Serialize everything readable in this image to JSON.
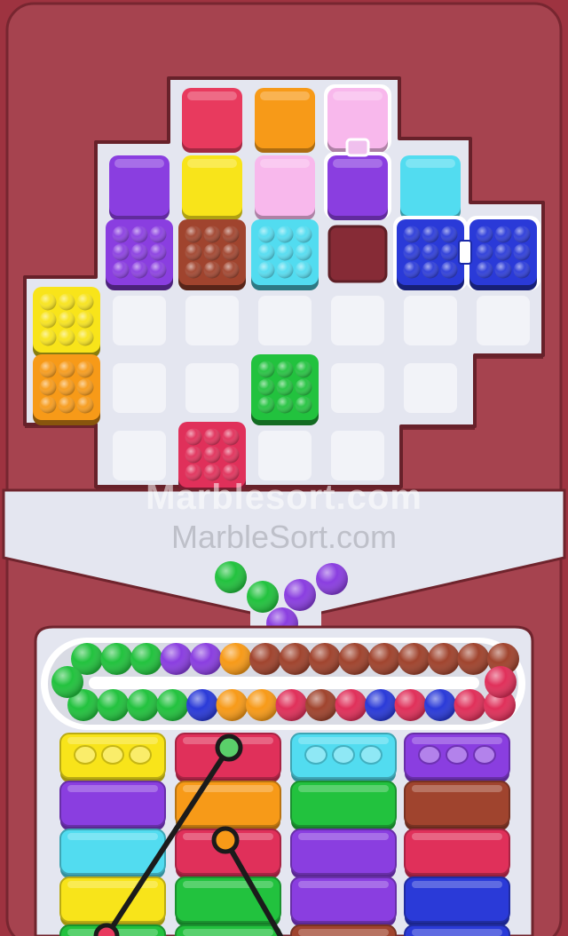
{
  "watermarks": {
    "primary": "Marblesort.com",
    "secondary": "MarbleSort.com"
  },
  "colors": {
    "frame": "#9e3340",
    "board": "#e4e6f0",
    "empty_slot": "#f2f3f8",
    "red": "#e83a5e",
    "orange": "#f79a18",
    "pink": "#f8b8ec",
    "purple": "#8a3ee0",
    "yellow": "#f8e41a",
    "cyan": "#52dcf0",
    "blue": "#2a3ad8",
    "brown": "#a0442e",
    "green": "#22c23e",
    "crimson": "#e0305a"
  },
  "board_pieces": {
    "flat_tiles": [
      {
        "row": 0,
        "col": 2,
        "color": "red"
      },
      {
        "row": 0,
        "col": 3,
        "color": "orange"
      },
      {
        "row": 0,
        "col": 4,
        "color": "pink",
        "selected": true
      },
      {
        "row": 1,
        "col": 1,
        "color": "purple"
      },
      {
        "row": 1,
        "col": 2,
        "color": "yellow"
      },
      {
        "row": 1,
        "col": 3,
        "color": "pink"
      },
      {
        "row": 1,
        "col": 4,
        "color": "purple",
        "selected": true
      },
      {
        "row": 1,
        "col": 5,
        "color": "cyan"
      }
    ],
    "marble_boxes": [
      {
        "row": 2,
        "col": 1,
        "color": "purple"
      },
      {
        "row": 2,
        "col": 2,
        "color": "brown"
      },
      {
        "row": 2,
        "col": 3,
        "color": "cyan"
      },
      {
        "row": 2,
        "col": 5,
        "color": "blue",
        "linked": true
      },
      {
        "row": 2,
        "col": 6,
        "color": "blue",
        "linked": true
      },
      {
        "row": 3,
        "col": 0,
        "color": "yellow"
      },
      {
        "row": 4,
        "col": 0,
        "color": "orange"
      },
      {
        "row": 4,
        "col": 3,
        "color": "green"
      },
      {
        "row": 5,
        "col": 2,
        "color": "crimson"
      }
    ],
    "hole": {
      "row": 2,
      "col": 4
    },
    "empty_slots": [
      [
        3,
        1
      ],
      [
        3,
        2
      ],
      [
        3,
        3
      ],
      [
        3,
        4
      ],
      [
        3,
        5
      ],
      [
        3,
        6
      ],
      [
        4,
        1
      ],
      [
        4,
        2
      ],
      [
        4,
        4
      ],
      [
        4,
        5
      ],
      [
        5,
        1
      ],
      [
        5,
        3
      ],
      [
        5,
        4
      ]
    ]
  },
  "falling_marbles": [
    "green",
    "green",
    "purple",
    "purple",
    "purple"
  ],
  "conveyor": {
    "top_row": [
      "green",
      "green",
      "green",
      "purple",
      "purple",
      "orange",
      "brown",
      "brown",
      "brown",
      "brown",
      "brown",
      "brown",
      "brown",
      "brown",
      "brown"
    ],
    "bottom_row": [
      "green",
      "green",
      "green",
      "green",
      "blue",
      "orange",
      "orange",
      "crimson",
      "brown",
      "crimson",
      "blue",
      "crimson",
      "blue",
      "crimson",
      "crimson"
    ],
    "left_end": "green",
    "right_end": "crimson"
  },
  "trays": [
    {
      "column": 1,
      "layers": [
        "yellow",
        "purple",
        "cyan",
        "yellow",
        "green"
      ],
      "open_slots": 3
    },
    {
      "column": 2,
      "layers": [
        "crimson",
        "orange",
        "crimson",
        "green",
        "green"
      ],
      "open_slots": 0
    },
    {
      "column": 3,
      "layers": [
        "cyan",
        "green",
        "purple",
        "purple",
        "brown"
      ],
      "open_slots": 3
    },
    {
      "column": 4,
      "layers": [
        "purple",
        "brown",
        "crimson",
        "blue",
        "blue"
      ],
      "open_slots": 3
    }
  ]
}
